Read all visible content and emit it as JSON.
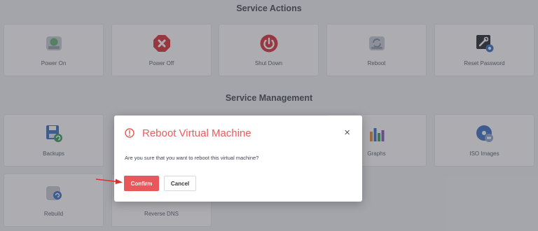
{
  "service_actions": {
    "title": "Service Actions",
    "items": [
      {
        "label": "Power On",
        "icon": "power-on-icon"
      },
      {
        "label": "Power Off",
        "icon": "power-off-icon"
      },
      {
        "label": "Shut Down",
        "icon": "shut-down-icon"
      },
      {
        "label": "Reboot",
        "icon": "reboot-icon"
      },
      {
        "label": "Reset Password",
        "icon": "reset-password-icon"
      }
    ]
  },
  "service_management": {
    "title": "Service Management",
    "items": [
      {
        "label": "Backups",
        "icon": "backups-icon"
      },
      {
        "label": "Graphs",
        "icon": "graphs-icon"
      },
      {
        "label": "ISO Images",
        "icon": "iso-images-icon"
      },
      {
        "label": "Rebuild",
        "icon": "rebuild-icon"
      },
      {
        "label": "Reverse DNS",
        "icon": "reverse-dns-icon"
      }
    ]
  },
  "modal": {
    "title": "Reboot Virtual Machine",
    "message": "Are you sure that you want to reboot this virtual machine?",
    "confirm_label": "Confirm",
    "cancel_label": "Cancel",
    "close_glyph": "×"
  },
  "colors": {
    "danger": "#e85c5c",
    "accent_blue": "#3e74c6"
  }
}
